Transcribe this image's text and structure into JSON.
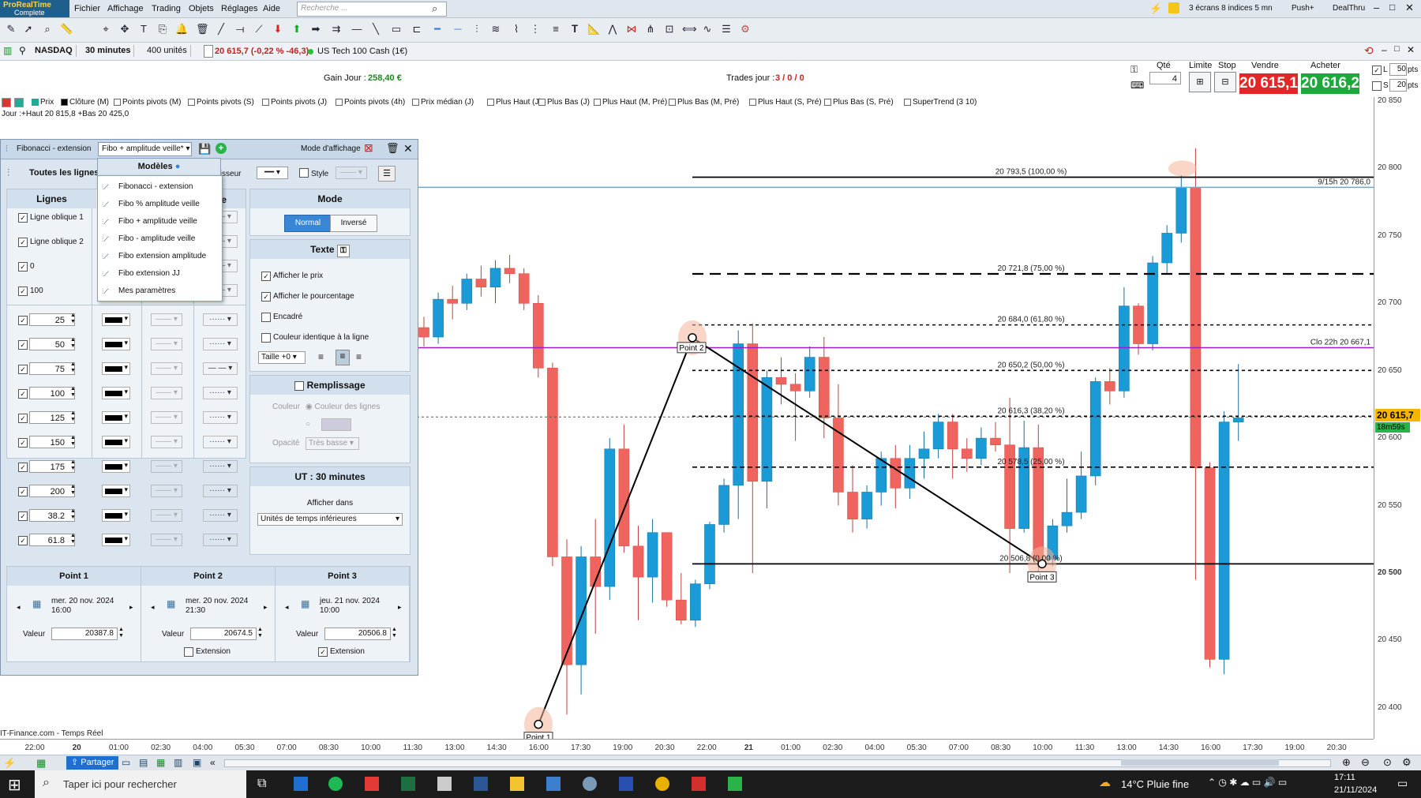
{
  "app": {
    "logo_line1": "ProRealTime",
    "logo_line2": "Complete",
    "menu": [
      "Fichier",
      "Affichage",
      "Trading",
      "Objets",
      "Réglages",
      "Aide"
    ],
    "search_placeholder": "Recherche ...",
    "right_status": "3 écrans 8 indices 5 mn",
    "push_label": "Push+",
    "dealthru_label": "DealThru"
  },
  "instrument": {
    "market": "NASDAQ",
    "timeframe": "30 minutes",
    "units": "400 unités",
    "price_change": "20 615,7 (-0,22 % -46,3)",
    "name": "US Tech 100 Cash (1€)"
  },
  "trade_bar": {
    "gain_label": "Gain Jour :",
    "gain_value": "258,40 €",
    "trades_label": "Trades jour :",
    "trades_value": "3 / 0 / 0",
    "qty_label": "Qté",
    "qty_value": "4",
    "limit_label": "Limite",
    "stop_label": "Stop",
    "sell_label": "Vendre",
    "buy_label": "Acheter",
    "sell_price": "20 615,1",
    "buy_price": "20 616,2",
    "l_label": "L",
    "s_label": "S",
    "l_pts": "50",
    "s_pts": "20",
    "pts_unit": "pts"
  },
  "indicators": [
    "Prix",
    "Clôture (M)",
    "Points pivots (M)",
    "Points pivots (S)",
    "Points pivots (J)",
    "Points pivots (4h)",
    "Prix médian (J)",
    "Plus Haut (J)",
    "Plus Bas (J)",
    "Plus Haut (M, Pré)",
    "Plus Bas (M, Pré)",
    "Plus Haut (S, Pré)",
    "Plus Bas (S, Pré)",
    "SuperTrend (3 10)"
  ],
  "day_info": "Jour :+Haut 20 815,8 +Bas 20 425,0",
  "footer_source": "IT-Finance.com - Temps Réel",
  "panel": {
    "tab1": "Fibonacci - extension",
    "tab2": "Fibo + amplitude veille*",
    "display_mode": "Mode d'affichage",
    "all_lines": "Toutes les lignes",
    "thickness": "Épaisseur",
    "style_label": "Style",
    "lines_header": "Lignes",
    "col_header_style": "le",
    "mode_header": "Mode",
    "mode_normal": "Normal",
    "mode_inverse": "Inversé",
    "text_header": "Texte",
    "show_price": "Afficher le prix",
    "show_percent": "Afficher le pourcentage",
    "framed": "Encadré",
    "same_color": "Couleur identique à la ligne",
    "size": "Taille +0",
    "fill_header": "Remplissage",
    "color_label": "Couleur",
    "line_colors": "Couleur des lignes",
    "opacity_label": "Opacité",
    "opacity_value": "Très basse",
    "ut_header": "UT : 30 minutes",
    "show_in": "Afficher dans",
    "show_in_value": "Unités de temps inférieures",
    "check_rows": [
      "Ligne oblique 1",
      "Ligne oblique 2",
      "0",
      "100"
    ],
    "level_values": [
      "25",
      "50",
      "75",
      "100",
      "125",
      "150",
      "175",
      "200",
      "38.2",
      "61.8"
    ],
    "points": [
      {
        "title": "Point 1",
        "date": "mer. 20 nov. 2024",
        "time": "16:00",
        "value_label": "Valeur",
        "value": "20387.8"
      },
      {
        "title": "Point 2",
        "date": "mer. 20 nov. 2024",
        "time": "21:30",
        "value_label": "Valeur",
        "value": "20674.5",
        "ext_label": "Extension"
      },
      {
        "title": "Point 3",
        "date": "jeu. 21 nov. 2024",
        "time": "10:00",
        "value_label": "Valeur",
        "value": "20506.8",
        "ext_label": "Extension"
      }
    ],
    "models_title": "Modèles",
    "models": [
      "Fibonacci - extension",
      "Fibo % amplitude veille",
      "Fibo + amplitude veille",
      "Fibo - amplitude veille",
      "Fibo extension amplitude",
      "Fibo extension JJ",
      "Mes paramètres"
    ]
  },
  "chart_data": {
    "type": "candlestick",
    "instrument": "US Tech 100 Cash (1€)",
    "timeframe": "30 minutes",
    "ylim": [
      20380,
      20850
    ],
    "y_ticks": [
      "20 850",
      "20 800",
      "20 750",
      "20 700",
      "20 650",
      "20 600",
      "20 550",
      "20 500",
      "20 450",
      "20 400"
    ],
    "x_ticks": [
      "22:00",
      "20",
      "01:00",
      "02:30",
      "04:00",
      "05:30",
      "07:00",
      "08:30",
      "10:00",
      "11:30",
      "13:00",
      "14:30",
      "16:00",
      "17:30",
      "19:00",
      "20:30",
      "22:00",
      "21",
      "01:00",
      "02:30",
      "04:00",
      "05:30",
      "07:00",
      "08:30",
      "10:00",
      "11:30",
      "13:00",
      "14:30",
      "16:00",
      "17:30",
      "19:00",
      "20:30"
    ],
    "fib_levels": [
      {
        "label": "20 793,5 (100,00 %)",
        "value": 20793.5
      },
      {
        "label": "20 721,8 (75,00 %)",
        "value": 20721.8
      },
      {
        "label": "20 684,0 (61,80 %)",
        "value": 20684.0
      },
      {
        "label": "20 650,2 (50,00 %)",
        "value": 20650.2
      },
      {
        "label": "20 616,3 (38,20 %)",
        "value": 20616.3
      },
      {
        "label": "20 578,5 (25,00 %)",
        "value": 20578.5
      },
      {
        "label": "20 506,8 (0,00 %)",
        "value": 20506.8
      }
    ],
    "ref_lines": [
      {
        "label": "9/15h 20 786,0",
        "value": 20786.0,
        "color": "#4fb3e8"
      },
      {
        "label": "Clo 22h 20 667,1",
        "value": 20667.1,
        "color": "#9b1bd1"
      }
    ],
    "points": [
      {
        "label": "Point 1",
        "value": 20387.8
      },
      {
        "label": "Point 2",
        "value": 20674.5
      },
      {
        "label": "Point 3",
        "value": 20506.8
      }
    ],
    "last_price": "20 615,7",
    "countdown": "18m59s",
    "candles": [
      [
        20682,
        20690,
        20668,
        20675
      ],
      [
        20675,
        20708,
        20670,
        20703
      ],
      [
        20703,
        20713,
        20688,
        20700
      ],
      [
        20700,
        20722,
        20695,
        20718
      ],
      [
        20718,
        20728,
        20705,
        20712
      ],
      [
        20712,
        20732,
        20700,
        20726
      ],
      [
        20726,
        20736,
        20715,
        20722
      ],
      [
        20722,
        20726,
        20695,
        20700
      ],
      [
        20700,
        20706,
        20645,
        20652
      ],
      [
        20652,
        20656,
        20505,
        20512
      ],
      [
        20512,
        20525,
        20395,
        20432
      ],
      [
        20432,
        20520,
        20410,
        20512
      ],
      [
        20512,
        20540,
        20455,
        20490
      ],
      [
        20490,
        20600,
        20480,
        20592
      ],
      [
        20592,
        20610,
        20515,
        20520
      ],
      [
        20520,
        20535,
        20465,
        20497
      ],
      [
        20497,
        20540,
        20478,
        20530
      ],
      [
        20530,
        20530,
        20475,
        20480
      ],
      [
        20480,
        20500,
        20462,
        20465
      ],
      [
        20465,
        20495,
        20460,
        20492
      ],
      [
        20492,
        20538,
        20488,
        20536
      ],
      [
        20536,
        20570,
        20530,
        20565
      ],
      [
        20565,
        20680,
        20540,
        20670
      ],
      [
        20670,
        20685,
        20500,
        20568
      ],
      [
        20568,
        20650,
        20548,
        20645
      ],
      [
        20645,
        20660,
        20625,
        20640
      ],
      [
        20640,
        20648,
        20598,
        20635
      ],
      [
        20635,
        20668,
        20630,
        20660
      ],
      [
        20660,
        20675,
        20600,
        20615
      ],
      [
        20615,
        20640,
        20550,
        20560
      ],
      [
        20560,
        20580,
        20530,
        20540
      ],
      [
        20540,
        20565,
        20533,
        20560
      ],
      [
        20560,
        20590,
        20550,
        20585
      ],
      [
        20585,
        20595,
        20548,
        20563
      ],
      [
        20563,
        20595,
        20555,
        20585
      ],
      [
        20585,
        20605,
        20570,
        20592
      ],
      [
        20592,
        20618,
        20585,
        20612
      ],
      [
        20612,
        20618,
        20570,
        20592
      ],
      [
        20592,
        20600,
        20575,
        20585
      ],
      [
        20585,
        20608,
        20580,
        20600
      ],
      [
        20600,
        20612,
        20590,
        20595
      ],
      [
        20595,
        20630,
        20500,
        20533
      ],
      [
        20533,
        20613,
        20530,
        20593
      ],
      [
        20593,
        20610,
        20500,
        20510
      ],
      [
        20510,
        20540,
        20505,
        20535
      ],
      [
        20535,
        20570,
        20530,
        20545
      ],
      [
        20545,
        20590,
        20540,
        20572
      ],
      [
        20572,
        20645,
        20565,
        20642
      ],
      [
        20642,
        20652,
        20625,
        20635
      ],
      [
        20635,
        20712,
        20630,
        20698
      ],
      [
        20698,
        20700,
        20662,
        20670
      ],
      [
        20670,
        20735,
        20665,
        20730
      ],
      [
        20730,
        20758,
        20722,
        20752
      ],
      [
        20752,
        20795,
        20745,
        20786
      ],
      [
        20786,
        20815,
        20495,
        20578
      ],
      [
        20578,
        20582,
        20430,
        20436
      ],
      [
        20436,
        20620,
        20425,
        20612
      ],
      [
        20612,
        20655,
        20598,
        20615
      ]
    ]
  }
}
